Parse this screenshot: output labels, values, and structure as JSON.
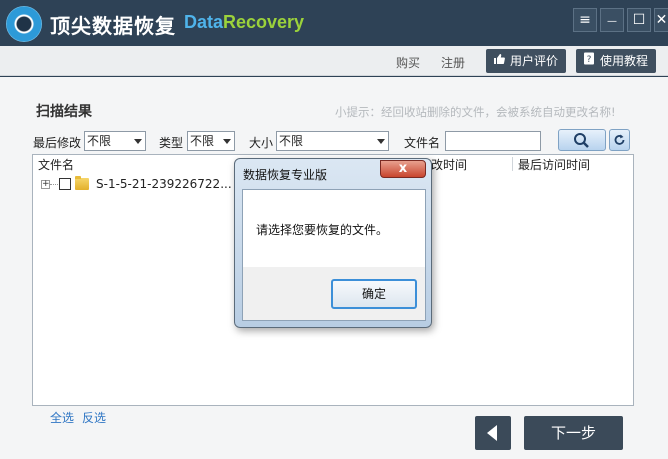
{
  "app": {
    "title": "顶尖数据恢复",
    "brand_part1": "Data",
    "brand_part2": "Recovery",
    "colors": {
      "titlebar": "#2e4256",
      "brand_blue": "#4fb3ea",
      "brand_green": "#9bd23b",
      "link": "#2f76c4"
    }
  },
  "window_controls": {
    "menu_icon": "≡",
    "minimize_icon": "—",
    "maximize_icon": "☐",
    "close_icon": "✕"
  },
  "toolbar": {
    "buy": "购买",
    "register": "注册",
    "review": "用户评价",
    "review_icon": "thumbs-up-icon",
    "tutorial": "使用教程",
    "tutorial_icon": "help-book-icon"
  },
  "scan": {
    "title": "扫描结果",
    "hint": "小提示：经回收站删除的文件，会被系统自动更改名称!"
  },
  "filters": {
    "last_modified_label": "最后修改",
    "last_modified_value": "不限",
    "type_label": "类型",
    "type_value": "不限",
    "size_label": "大小",
    "size_value": "不限",
    "filename_label": "文件名",
    "filename_value": ""
  },
  "filelist": {
    "columns": [
      "文件名",
      "改时间",
      "最后访问时间"
    ],
    "rows": [
      {
        "name": "S-1-5-21-239226722...",
        "checked": false,
        "expanded": false
      }
    ]
  },
  "footer": {
    "select_all": "全选",
    "invert": "反选",
    "next": "下一步"
  },
  "dialog": {
    "title": "数据恢复专业版",
    "message": "请选择您要恢复的文件。",
    "ok": "确定",
    "close_icon": "x"
  }
}
